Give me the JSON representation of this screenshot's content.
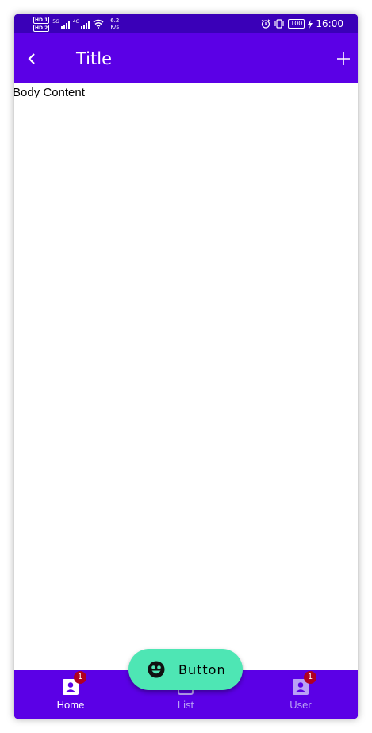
{
  "status_bar": {
    "hd1": "HD 1",
    "hd2": "HD 2",
    "net1": "5G",
    "net2": "4G",
    "speed_value": "6.2",
    "speed_unit": "K/s",
    "battery": "100",
    "time": "16:00"
  },
  "app_bar": {
    "title": "Title",
    "back_icon": "chevron-left-icon",
    "add_icon": "plus-icon"
  },
  "body": {
    "text": "Body Content"
  },
  "fab": {
    "label": "Button",
    "icon": "emoji-face-icon",
    "color": "#4ee6b4"
  },
  "bottom_nav": {
    "items": [
      {
        "label": "Home",
        "icon": "account-box-icon",
        "badge": "1",
        "active": true
      },
      {
        "label": "List",
        "icon": "list-icon",
        "badge": "",
        "active": false
      },
      {
        "label": "User",
        "icon": "account-box-icon",
        "badge": "1",
        "active": false
      }
    ]
  },
  "colors": {
    "primary": "#5b00e6",
    "status_bar": "#3a00b8",
    "accent": "#4ee6b4",
    "badge": "#b00020"
  }
}
